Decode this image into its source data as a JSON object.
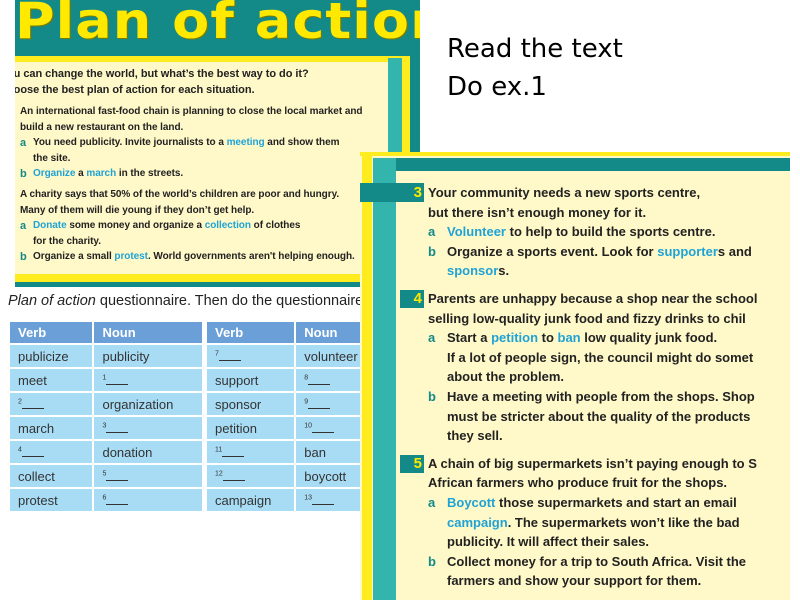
{
  "top_page": {
    "title": "Plan of action",
    "intro": [
      "ou can change the world, but what’s the best way to do it?",
      "hoose the best plan of action for each situation."
    ],
    "situations": [
      {
        "stem": [
          [
            "An international fast-food chain is planning to close the local market and"
          ],
          [
            "build a new restaurant on the land."
          ]
        ],
        "options": [
          {
            "letter": "a",
            "lines": [
              [
                "You need publicity. Invite journalists to a ",
                {
                  "hl": "meeting"
                },
                " and show them"
              ],
              [
                "the site."
              ]
            ]
          },
          {
            "letter": "b",
            "lines": [
              [
                {
                  "hl": "Organize"
                },
                " a ",
                {
                  "hl": "march"
                },
                " in the streets."
              ]
            ]
          }
        ]
      },
      {
        "stem": [
          [
            "A charity says that 50% of the world’s children are poor and hungry."
          ],
          [
            "Many of them will die young if they don’t get help."
          ]
        ],
        "options": [
          {
            "letter": "a",
            "lines": [
              [
                {
                  "hl": "Donate"
                },
                " some money and organize a ",
                {
                  "hl": "collection"
                },
                " of clothes"
              ],
              [
                "for the charity."
              ]
            ]
          },
          {
            "letter": "b",
            "lines": [
              [
                "Organize a small ",
                {
                  "hl": "protest"
                },
                ". World governments aren't helping enough."
              ]
            ]
          }
        ]
      }
    ]
  },
  "instructions": [
    "Read the text",
    "Do ex.1"
  ],
  "questionnaire": {
    "caption_italic": "Plan of action",
    "caption_rest": " questionnaire. Then do the questionnaire.",
    "tables": [
      {
        "headers": [
          "Verb",
          "Noun"
        ],
        "rows": [
          [
            "publicize",
            "publicity"
          ],
          [
            "meet",
            {
              "n": "1"
            }
          ],
          [
            {
              "n": "2"
            },
            "organization"
          ],
          [
            "march",
            {
              "n": "3"
            }
          ],
          [
            {
              "n": "4"
            },
            "donation"
          ],
          [
            "collect",
            {
              "n": "5"
            }
          ],
          [
            "protest",
            {
              "n": "6"
            }
          ]
        ]
      },
      {
        "headers": [
          "Verb",
          "Noun"
        ],
        "rows": [
          [
            {
              "n": "7"
            },
            "volunteer"
          ],
          [
            "support",
            {
              "n": "8"
            }
          ],
          [
            "sponsor",
            {
              "n": "9"
            }
          ],
          [
            "petition",
            {
              "n": "10"
            }
          ],
          [
            {
              "n": "11"
            },
            "ban"
          ],
          [
            {
              "n": "12"
            },
            "boycott"
          ],
          [
            "campaign",
            {
              "n": "13"
            }
          ]
        ]
      }
    ]
  },
  "right_page": {
    "situations": [
      {
        "number": "3",
        "stem": [
          [
            "Your community needs a new sports centre,"
          ],
          [
            "but there isn’t enough money for it."
          ]
        ],
        "options": [
          {
            "letter": "a",
            "lines": [
              [
                {
                  "hl": "Volunteer"
                },
                " to help to build the sports centre."
              ]
            ]
          },
          {
            "letter": "b",
            "lines": [
              [
                "Organize a sports event. Look for ",
                {
                  "hl": "supporter"
                },
                "s and"
              ],
              [
                {
                  "hl": "sponsor"
                },
                "s."
              ]
            ]
          }
        ]
      },
      {
        "number": "4",
        "stem": [
          [
            "Parents are unhappy because a shop near the school"
          ],
          [
            "selling low-quality junk food and fizzy drinks to chil"
          ]
        ],
        "options": [
          {
            "letter": "a",
            "lines": [
              [
                "Start a ",
                {
                  "hl": "petition"
                },
                " to ",
                {
                  "hl": "ban"
                },
                " low quality junk food."
              ],
              [
                "If a lot of people sign, the council might do somet"
              ],
              [
                "about the problem."
              ]
            ]
          },
          {
            "letter": "b",
            "lines": [
              [
                "Have a meeting with people from the shops. Shop"
              ],
              [
                "must be stricter about the quality of the products"
              ],
              [
                "they sell."
              ]
            ]
          }
        ]
      },
      {
        "number": "5",
        "stem": [
          [
            "A chain of big supermarkets isn’t paying enough to S"
          ],
          [
            "African farmers who produce fruit for the shops."
          ]
        ],
        "options": [
          {
            "letter": "a",
            "lines": [
              [
                {
                  "hl": "Boycott"
                },
                " those supermarkets and start an email"
              ],
              [
                {
                  "hl": "campaign"
                },
                ". The supermarkets won’t like the bad"
              ],
              [
                "publicity. It will affect their sales."
              ]
            ]
          },
          {
            "letter": "b",
            "lines": [
              [
                "Collect money for a trip to South Africa. Visit the"
              ],
              [
                "farmers and show your support for them."
              ]
            ]
          }
        ]
      }
    ]
  },
  "colors": {
    "teal": "#138a88",
    "light_teal": "#33b5ad",
    "yellow": "#ffec1f",
    "cream": "#fff8c8",
    "highlight_blue": "#1fa3d6",
    "table_header": "#6a9fd8",
    "table_cell": "#a8dcf5"
  }
}
